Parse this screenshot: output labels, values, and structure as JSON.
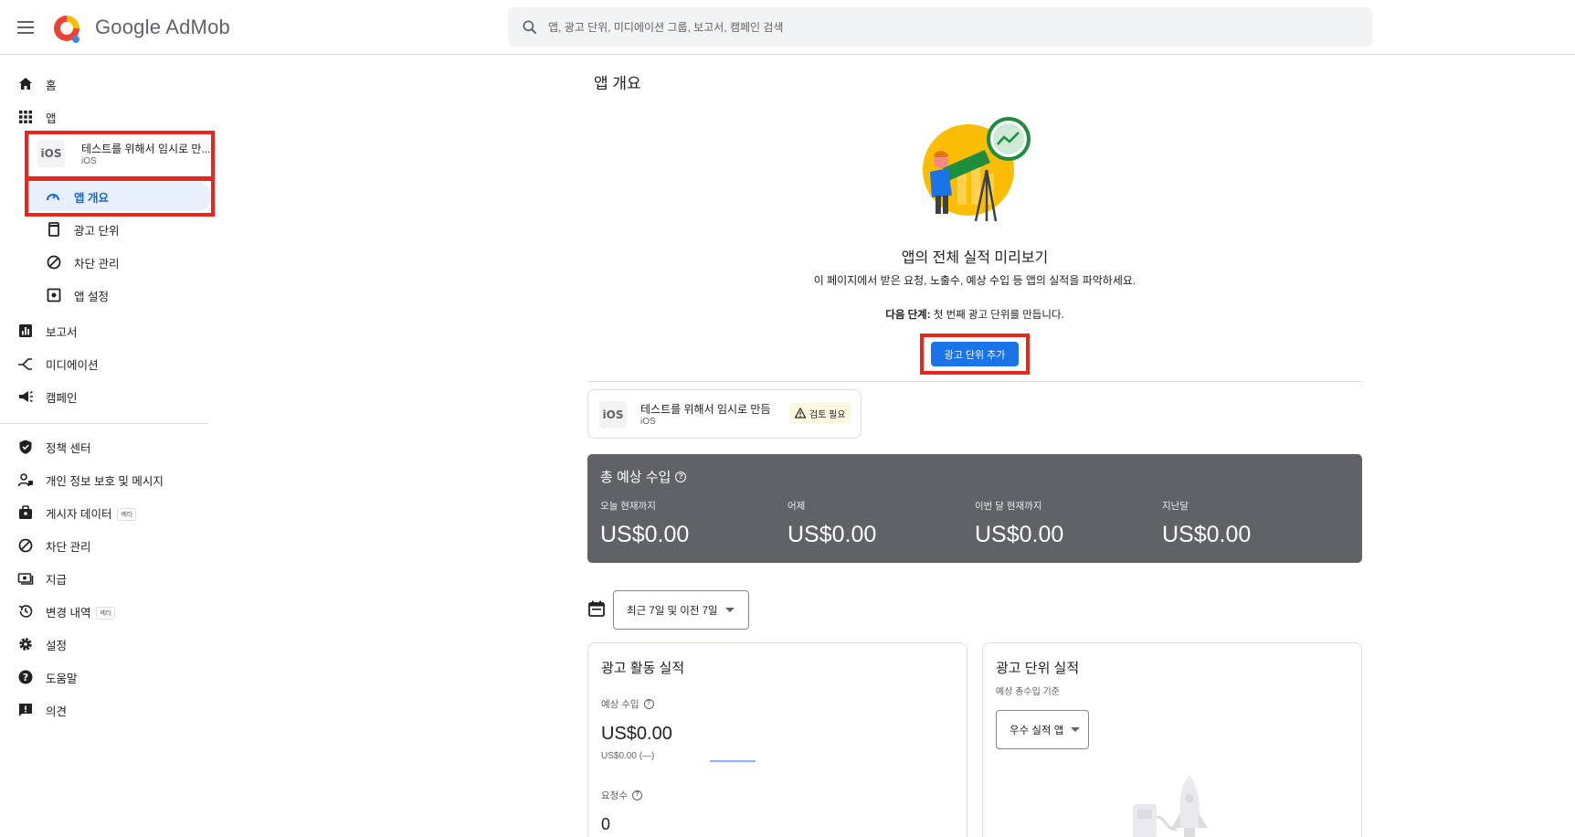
{
  "header": {
    "brand": "Google AdMob",
    "search_placeholder": "앱, 광고 단위, 미디에이션 그룹, 보고서, 캠페인 검색"
  },
  "sidebar": {
    "home": "홈",
    "apps": "앱",
    "app_card": {
      "name": "테스트를 위해서 임시로 만...",
      "platform": "iOS",
      "tile": "iOS"
    },
    "sub_items": [
      {
        "label": "앱 개요",
        "icon": "dashboard-icon",
        "active": true
      },
      {
        "label": "광고 단위",
        "icon": "ad-unit-icon"
      },
      {
        "label": "차단 관리",
        "icon": "block-icon"
      },
      {
        "label": "앱 설정",
        "icon": "app-settings-icon"
      }
    ],
    "items_a": [
      {
        "label": "보고서",
        "icon": "report-icon"
      },
      {
        "label": "미디에이션",
        "icon": "mediation-icon"
      },
      {
        "label": "캠페인",
        "icon": "campaign-icon"
      }
    ],
    "items_b": [
      {
        "label": "정책 센터",
        "icon": "policy-shield-icon"
      },
      {
        "label": "개인 정보 보호 및 메시지",
        "icon": "privacy-icon"
      },
      {
        "label": "게시자 데이터",
        "icon": "publisher-data-icon",
        "badge": "베타"
      },
      {
        "label": "차단 관리",
        "icon": "block-icon"
      },
      {
        "label": "지급",
        "icon": "payments-icon"
      },
      {
        "label": "변경 내역",
        "icon": "history-icon",
        "badge": "베타"
      },
      {
        "label": "설정",
        "icon": "gear-icon"
      },
      {
        "label": "도움말",
        "icon": "help-icon"
      },
      {
        "label": "의견",
        "icon": "feedback-icon"
      }
    ]
  },
  "main": {
    "page_title": "앱 개요",
    "hero_title": "앱의 전체 실적 미리보기",
    "hero_subtitle": "이 페이지에서 받은 요청, 노출수, 예상 수입 등 앱의 실적을 파악하세요.",
    "next_step_label": "다음 단계:",
    "next_step_text": " 첫 번째 광고 단위를 만듭니다.",
    "add_ad_unit_button": "광고 단위 추가",
    "app_chip": {
      "name": "테스트를 위해서 임시로 만듬",
      "platform": "iOS",
      "tile": "iOS",
      "warning": "검토 필요"
    },
    "earnings": {
      "title": "총 예상 수입",
      "metrics": [
        {
          "label": "오늘 현재까지",
          "value": "US$0.00"
        },
        {
          "label": "어제",
          "value": "US$0.00"
        },
        {
          "label": "이번 달 현재까지",
          "value": "US$0.00"
        },
        {
          "label": "지난달",
          "value": "US$0.00"
        }
      ]
    },
    "date_range": "최근 7일 및 이전 7일",
    "ad_activity": {
      "title": "광고 활동 실적",
      "est_label": "예상 수입",
      "est_value": "US$0.00",
      "est_compare": "US$0.00 (—)",
      "requests_label": "요청수",
      "requests_value": "0"
    },
    "ad_unit_perf": {
      "title": "광고 단위 실적",
      "subtitle": "예상 총수입 기준",
      "selector": "우수 실적 앱"
    }
  },
  "colors": {
    "accent": "#1a73e8",
    "highlight": "#e8261b",
    "earnings_bg": "#5f6368"
  }
}
